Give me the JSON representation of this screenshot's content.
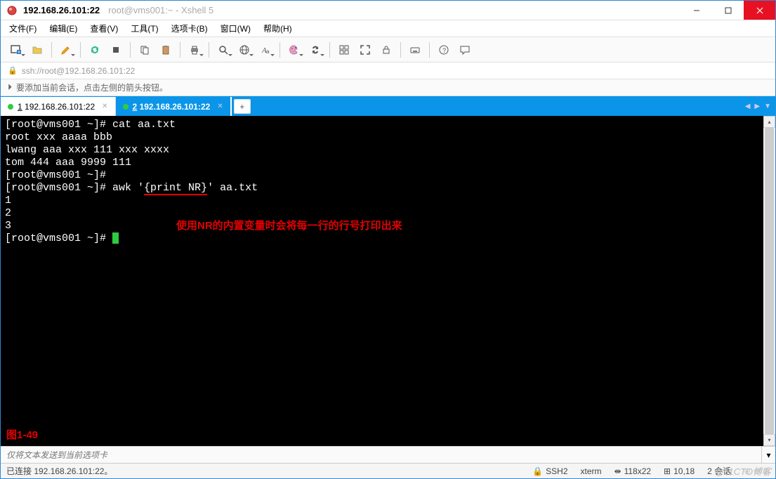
{
  "titlebar": {
    "title": "192.168.26.101:22",
    "subtitle": "root@vms001:~ - Xshell 5"
  },
  "menu": {
    "file": "文件(F)",
    "edit": "编辑(E)",
    "view": "查看(V)",
    "tools": "工具(T)",
    "tab": "选项卡(B)",
    "window": "窗口(W)",
    "help": "帮助(H)"
  },
  "address": {
    "url": "ssh://root@192.168.26.101:22"
  },
  "hint": {
    "text": "要添加当前会话，点击左侧的箭头按钮。"
  },
  "tabs": {
    "items": [
      {
        "num": "1",
        "label": "192.168.26.101:22",
        "active": false
      },
      {
        "num": "2",
        "label": "192.168.26.101:22",
        "active": true
      }
    ]
  },
  "terminal": {
    "lines": [
      "[root@vms001 ~]# cat aa.txt",
      "root xxx aaaa bbb",
      "lwang aaa xxx 111 xxx xxxx",
      "tom 444 aaa 9999 111",
      "[root@vms001 ~]#",
      "[root@vms001 ~]# awk '",
      "{print NR}",
      "' aa.txt",
      "1",
      "2",
      "3",
      "[root@vms001 ~]# "
    ],
    "annotation": "使用NR的内置变量时会将每一行的行号打印出来",
    "figure_label": "图1-49"
  },
  "sendbar": {
    "placeholder": "仅将文本发送到当前选项卡"
  },
  "status": {
    "connection": "已连接 192.168.26.101:22。",
    "protocol": "SSH2",
    "term": "xterm",
    "size": "118x22",
    "pos": "10,18",
    "sessions": "2 会话"
  },
  "watermark": "@51CTO博客",
  "icons": {
    "new_session": "new-session",
    "open": "open",
    "edit_pen": "edit",
    "reconnect": "reconnect",
    "disconnect": "disconnect",
    "copy": "copy",
    "paste": "paste",
    "print": "print",
    "find": "find",
    "globe": "globe",
    "font": "font",
    "palette": "palette",
    "cycle": "cycle",
    "grid": "grid",
    "fullscreen": "fullscreen",
    "lock": "lock",
    "keyboard": "keyboard",
    "help": "help",
    "chat": "chat"
  }
}
